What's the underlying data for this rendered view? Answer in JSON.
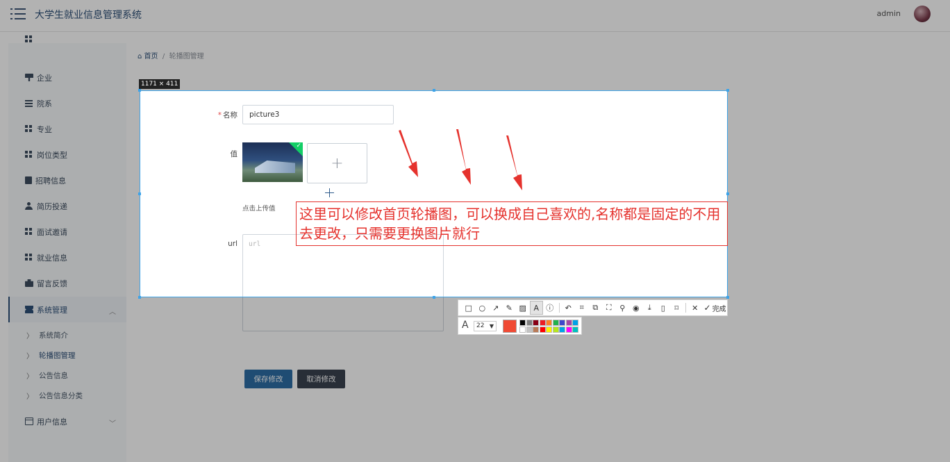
{
  "header": {
    "app_title": "大学生就业信息管理系统",
    "user_name": "admin"
  },
  "sidebar": {
    "items": [
      {
        "label": "企业",
        "icon": "shop-icon"
      },
      {
        "label": "院系",
        "icon": "list-icon"
      },
      {
        "label": "专业",
        "icon": "grid-icon"
      },
      {
        "label": "岗位类型",
        "icon": "grid-icon"
      },
      {
        "label": "招聘信息",
        "icon": "clipboard-icon"
      },
      {
        "label": "简历投递",
        "icon": "user-icon"
      },
      {
        "label": "面试邀请",
        "icon": "grid-icon"
      },
      {
        "label": "就业信息",
        "icon": "grid-icon"
      },
      {
        "label": "留言反馈",
        "icon": "briefcase-icon"
      },
      {
        "label": "系统管理",
        "icon": "ticket-icon",
        "expanded": true
      },
      {
        "label": "用户信息",
        "icon": "card-icon",
        "expanded": false
      }
    ],
    "sub_items": [
      {
        "label": "系统简介"
      },
      {
        "label": "轮播图管理",
        "current": true
      },
      {
        "label": "公告信息"
      },
      {
        "label": "公告信息分类"
      }
    ]
  },
  "breadcrumb": {
    "home": "首页",
    "separator": "/",
    "current": "轮播图管理"
  },
  "form": {
    "name_label": "名称",
    "required_mark": "*",
    "name_value": "picture3",
    "value_label": "值",
    "upload_plus": "+",
    "upload_hint": "点击上传值",
    "url_label": "url",
    "url_placeholder": "url",
    "save_button": "保存修改",
    "cancel_button": "取消修改"
  },
  "capture": {
    "size_badge": "1171 × 411",
    "annotation_text": "这里可以修改首页轮播图，可以换成自己喜欢的,名称都是固定的不用去更改，只需要更换图片就行",
    "annotation_color": "#e5322d",
    "toolbar_done": "完成",
    "font_size": "22",
    "current_color": "#f04a34",
    "swatches_top": [
      "#000000",
      "#7f7f7f",
      "#880015",
      "#ed1c24",
      "#ff7f27",
      "#22b14c",
      "#3f48cc",
      "#a349a4",
      "#00a2e8"
    ],
    "swatches_bottom": [
      "#ffffff",
      "#c3c3c3",
      "#b97a57",
      "#ff0000",
      "#fff200",
      "#b5e61d",
      "#00a2e8",
      "#ff00ff",
      "#00c0c0"
    ]
  },
  "colors": {
    "brand": "#2d4f77",
    "selection": "#3da3e8",
    "upload_success": "#13ce66"
  }
}
